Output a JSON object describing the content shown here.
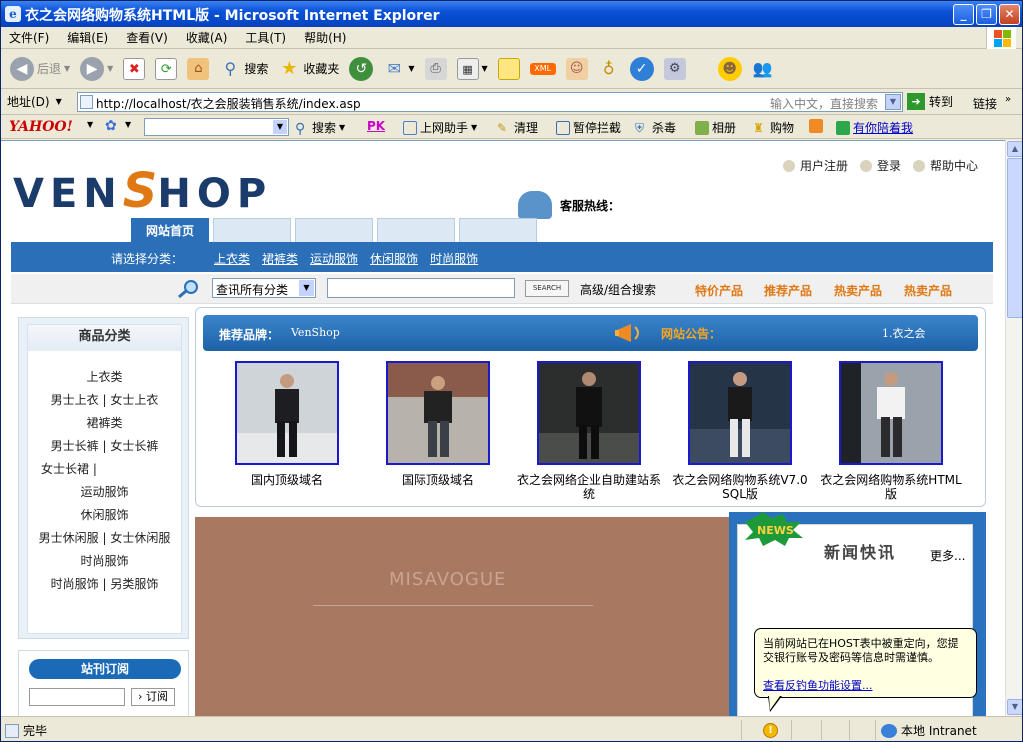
{
  "window": {
    "title": "衣之会网络购物系统HTML版 - Microsoft Internet Explorer",
    "ie_icon": "e"
  },
  "menubar": [
    "文件(F)",
    "编辑(E)",
    "查看(V)",
    "收藏(A)",
    "工具(T)",
    "帮助(H)"
  ],
  "toolbar": {
    "back": "后退",
    "search": "搜索",
    "favorites": "收藏夹",
    "xml_badge": "XML"
  },
  "address": {
    "label": "地址(D)",
    "url": "http://localhost/衣之会服装销售系统/index.asp",
    "hint": "输入中文，直接搜索",
    "go": "转到",
    "links": "链接"
  },
  "yahoo_bar": {
    "logo": "YAHOO!",
    "search": "搜索",
    "pk": "PK",
    "assistant": "上网助手",
    "clean": "清理",
    "block": "暂停拦截",
    "antivirus": "杀毒",
    "album": "相册",
    "shopping": "购物",
    "companion": "有你陪着我"
  },
  "site": {
    "logo_left": "VEN",
    "logo_s": "S",
    "logo_right": "HOP",
    "toplinks": [
      "用户注册",
      "登录",
      "帮助中心"
    ],
    "hotline": "客服热线：",
    "tabs": [
      "网站首页",
      "",
      "",
      "",
      ""
    ],
    "category_prompt": "请选择分类：",
    "categories": [
      "上衣类",
      "裙裤类",
      "运动服饰",
      "休闲服饰",
      "时尚服饰"
    ],
    "search": {
      "select_value": "查讯所有分类",
      "button": "SEARCH",
      "advanced": "高级/组合搜索",
      "hot_links": [
        "特价产品",
        "推荐产品",
        "热卖产品",
        "热卖产品"
      ]
    },
    "sidebar": {
      "title": "商品分类",
      "lines": [
        "上衣类",
        "男士上衣 | 女士上衣",
        "裙裤类",
        "男士长裤 | 女士长裤",
        "女士长裙 |",
        "运动服饰",
        "休闲服饰",
        "男士休闲服 | 女士休闲服",
        "时尚服饰",
        "时尚服饰 | 另类服饰"
      ]
    },
    "subscribe": {
      "title": "站刊订阅",
      "button": "订阅"
    },
    "brand": {
      "label": "推荐品牌：",
      "value": "VenShop",
      "notice_label": "网站公告：",
      "notice_item": "1.衣之会"
    },
    "products": [
      {
        "caption": "国内顶级域名"
      },
      {
        "caption": "国际顶级域名"
      },
      {
        "caption": "衣之会网络企业自助建站系统"
      },
      {
        "caption": "衣之会网络购物系统V7.0 SQL版"
      },
      {
        "caption": "衣之会网络购物系统HTML版"
      }
    ],
    "banner_brand": "MISAVOGUE",
    "news": {
      "badge": "NEWS",
      "title": "新闻快讯",
      "more": "更多..."
    }
  },
  "balloon": {
    "text": "当前网站已在HOST表中被重定向，您提交银行账号及密码等信息时需谨慎。",
    "link": "查看反钓鱼功能设置..."
  },
  "status": {
    "done": "完毕",
    "zone": "本地 Intranet"
  },
  "colors": {
    "nav_blue": "#2a6fb7",
    "hot_orange": "#e07814",
    "title_blue": "#0a52d8"
  }
}
